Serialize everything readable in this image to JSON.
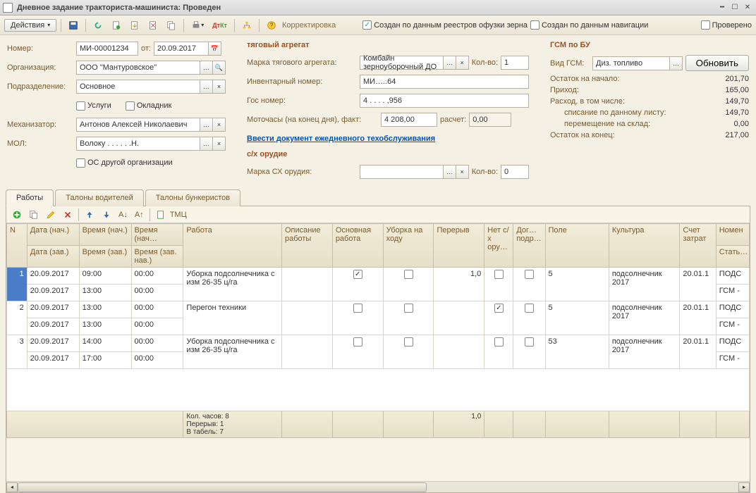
{
  "title": "Дневное задание тракториста-машиниста: Проведен",
  "toolbar": {
    "actions": "Действия",
    "corr": "Корректировка",
    "chk1": "Создан по данным реестров офузки зерна",
    "chk2": "Создан по данным навигации",
    "chk3": "Проверено"
  },
  "left": {
    "num_lbl": "Номер:",
    "num_val": "МИ-00001234",
    "from_lbl": "от:",
    "from_val": "20.09.2017",
    "org_lbl": "Организация:",
    "org_val": "ООО \"Мантуровское\"",
    "dept_lbl": "Подразделение:",
    "dept_val": "Основное",
    "svc": "Услуги",
    "okl": "Окладник",
    "mech_lbl": "Механизатор:",
    "mech_val": "Антонов Алексей Николаевич",
    "mol_lbl": "МОЛ:",
    "mol_val": "Волоку . . . . . .Н.",
    "other_org": "ОС другой организации"
  },
  "mid": {
    "header": "тяговый агрегат",
    "brand_lbl": "Марка тягового агрегата:",
    "brand_val": "Комбайн зерноуборочный ДО",
    "qty_lbl": "Кол-во:",
    "qty_val": "1",
    "inv_lbl": "Инвентарный номер:",
    "inv_val": "МИ…..64",
    "gos_lbl": "Гос номер:",
    "gos_val": "4 . . . . ,956",
    "moto_lbl": "Моточасы (на конец дня), факт:",
    "moto_val": "4 208,00",
    "calc_lbl": "расчет:",
    "calc_val": "0,00",
    "link": "Ввести документ ежедневного техобслуживания",
    "sx": "с/х орудие",
    "sx_brand_lbl": "Марка СХ орудия:",
    "sx_qty_lbl": "Кол-во:",
    "sx_qty_val": "0"
  },
  "right": {
    "header": "ГСМ по БУ",
    "type_lbl": "Вид ГСМ:",
    "type_val": "Диз. топливо",
    "upd_btn": "Обновить",
    "r1l": "Остаток на начало:",
    "r1v": "201,70",
    "r2l": "Приход:",
    "r2v": "165,00",
    "r3l": "Расход,  в том числе:",
    "r3v": "149,70",
    "r4l": "списание по данному листу:",
    "r4v": "149,70",
    "r5l": "перемещение на склад:",
    "r5v": "0,00",
    "r6l": "Остаток на конец:",
    "r6v": "217,00"
  },
  "tabs": [
    "Работы",
    "Талоны водителей",
    "Талоны бункеристов"
  ],
  "grid_toolbar": {
    "tmc": "ТМЦ"
  },
  "headers": {
    "n": "N",
    "d1": "Дата (нач.)",
    "d2": "Дата (зав.)",
    "t1": "Время (нач.)",
    "t2": "Время (зав.)",
    "tn1": "Время (нач…",
    "tn2": "Время (зав. нав.)",
    "work": "Работа",
    "desc": "Описание работы",
    "main": "Основная работа",
    "harvest": "Уборка на ходу",
    "break": "Перерыв",
    "nosx": "Нет с/х ору…",
    "dog": "Дог… подр…",
    "field": "Поле",
    "culture": "Культура",
    "acc": "Счет затрат",
    "nom": "Номен",
    "art": "Стать…"
  },
  "rows": [
    {
      "n": "1",
      "ds": "20.09.2017",
      "de": "20.09.2017",
      "ts": "09:00",
      "te": "13:00",
      "tns": "00:00",
      "tne": "00:00",
      "work": "Уборка подсолнечника с изм 26-35 ц/га",
      "main": true,
      "harvest": false,
      "br": "1,0",
      "nosx": false,
      "dog": false,
      "field": "5",
      "culture": "подсолнечник 2017",
      "acc": "20.01.1",
      "nom": "ПОДС",
      "art": "ГСМ -"
    },
    {
      "n": "2",
      "ds": "20.09.2017",
      "de": "20.09.2017",
      "ts": "13:00",
      "te": "13:00",
      "tns": "00:00",
      "tne": "00:00",
      "work": "Перегон техники",
      "main": false,
      "harvest": false,
      "br": "",
      "nosx": true,
      "dog": false,
      "field": "5",
      "culture": "подсолнечник 2017",
      "acc": "20.01.1",
      "nom": "ПОДС",
      "art": "ГСМ -"
    },
    {
      "n": "3",
      "ds": "20.09.2017",
      "de": "20.09.2017",
      "ts": "14:00",
      "te": "17:00",
      "tns": "00:00",
      "tne": "00:00",
      "work": "Уборка подсолнечника с изм 26-35 ц/га",
      "main": false,
      "harvest": false,
      "br": "",
      "nosx": false,
      "dog": false,
      "field": "53",
      "culture": "подсолнечник 2017",
      "acc": "20.01.1",
      "nom": "ПОДС",
      "art": "ГСМ -"
    }
  ],
  "footer": {
    "hours": "Кол. часов: 8",
    "break": "Перерыв: 1",
    "tabel": "В табель: 7",
    "br_total": "1,0"
  }
}
